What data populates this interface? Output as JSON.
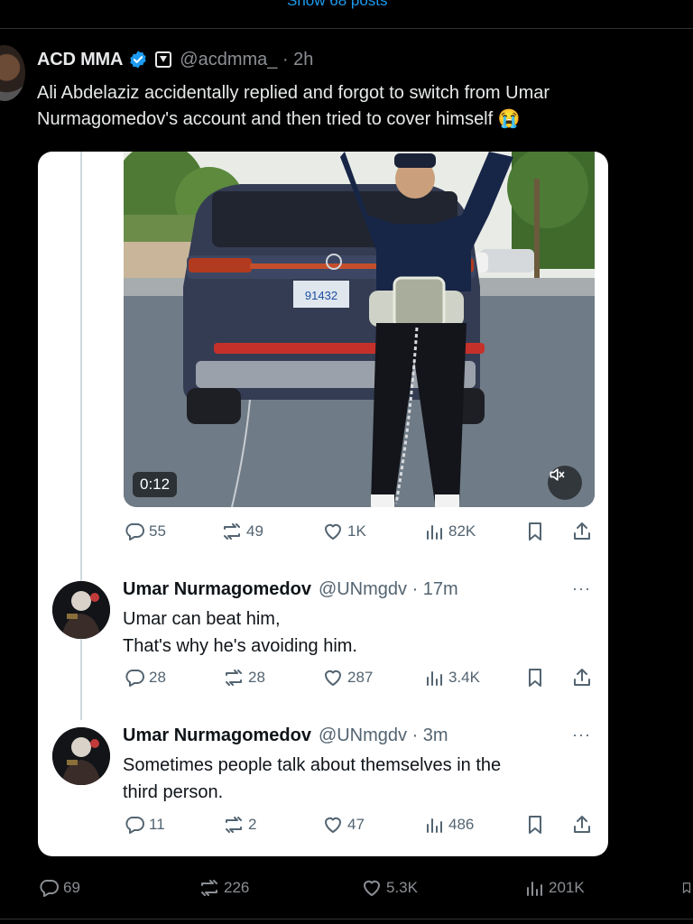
{
  "top": {
    "show_posts_label": "Show 68 posts"
  },
  "tweet": {
    "author_name": "ACD MMA",
    "author_handle": "@acdmma_ · 2h",
    "text": "Ali Abdelaziz accidentally replied and forgot to switch from Umar Nurmagomedov's account and then tried to cover himself 😭",
    "video": {
      "duration": "0:12",
      "plate_text": "91432"
    },
    "stats": {
      "replies": "55",
      "reposts": "49",
      "likes": "1K",
      "views": "82K"
    },
    "footer_stats": {
      "replies": "69",
      "reposts": "226",
      "likes": "5.3K",
      "views": "201K"
    }
  },
  "replies": [
    {
      "name": "Umar Nurmagomedov",
      "handle": "@UNmgdv · 17m",
      "line1": "Umar can beat him,",
      "line2": "That's why he's avoiding him.",
      "more": "···",
      "stats": {
        "replies": "28",
        "reposts": "28",
        "likes": "287",
        "views": "3.4K"
      }
    },
    {
      "name": "Umar Nurmagomedov",
      "handle": "@UNmgdv · 3m",
      "line1": "Sometimes people talk about themselves in the",
      "line2": "third person.",
      "more": "···",
      "stats": {
        "replies": "11",
        "reposts": "2",
        "likes": "47",
        "views": "486"
      }
    }
  ],
  "colors": {
    "verified": "#1d9bf0",
    "link": "#1d9bf0",
    "muted": "#536471",
    "bg": "#000000"
  },
  "icons": [
    "verified-icon",
    "affiliate-badge-icon",
    "reply-icon",
    "repost-icon",
    "like-icon",
    "views-icon",
    "bookmark-icon",
    "share-icon",
    "mute-icon",
    "more-icon"
  ]
}
